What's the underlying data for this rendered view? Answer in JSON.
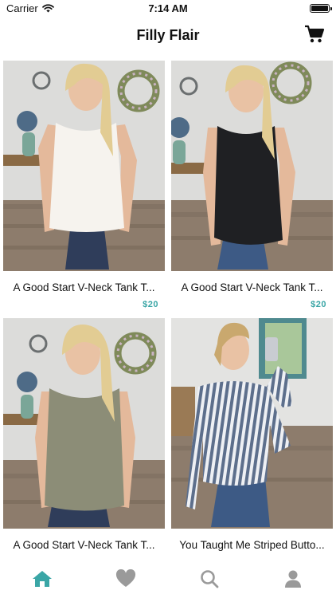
{
  "status_bar": {
    "carrier": "Carrier",
    "time": "7:14 AM"
  },
  "nav": {
    "title": "Filly Flair",
    "cart_icon": "cart-icon"
  },
  "products": [
    {
      "name": "A Good Start V-Neck Tank T...",
      "price": "$20",
      "color": "white"
    },
    {
      "name": "A Good Start V-Neck Tank T...",
      "price": "$20",
      "color": "black"
    },
    {
      "name": "A Good Start V-Neck Tank T...",
      "price": "",
      "color": "olive"
    },
    {
      "name": "You Taught Me Striped Butto...",
      "price": "",
      "color": "stripe"
    }
  ],
  "tabs": [
    {
      "name": "home",
      "icon": "home-icon",
      "active": true
    },
    {
      "name": "favorites",
      "icon": "heart-icon",
      "active": false
    },
    {
      "name": "search",
      "icon": "search-icon",
      "active": false
    },
    {
      "name": "profile",
      "icon": "profile-icon",
      "active": false
    }
  ],
  "colors": {
    "accent": "#3aa6a6",
    "inactive_icon": "#9a9a9a",
    "text": "#111111"
  }
}
